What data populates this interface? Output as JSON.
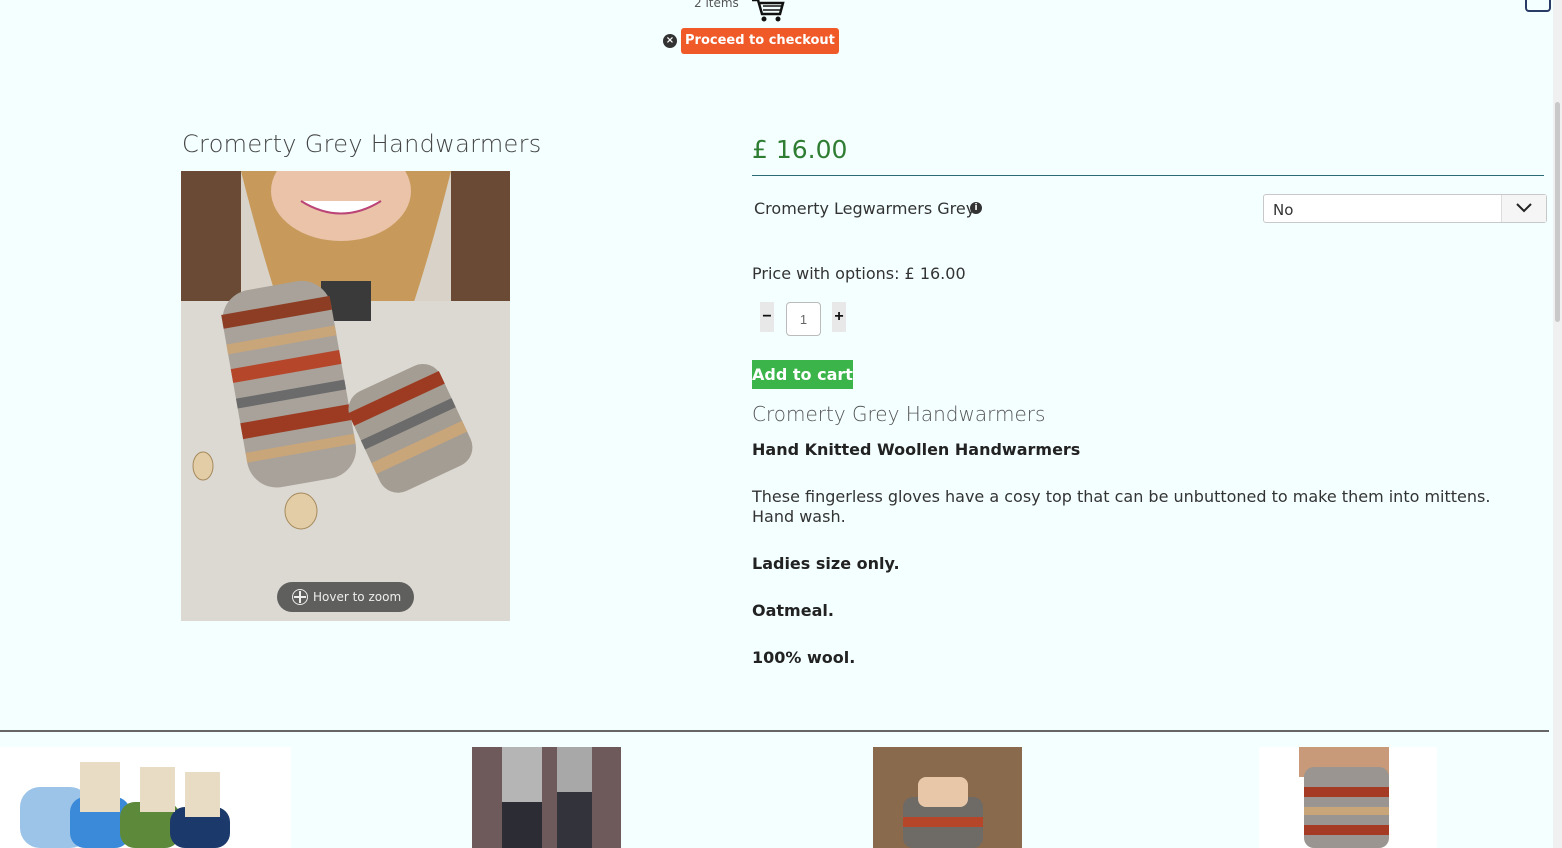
{
  "cart": {
    "count_text": "2 items",
    "checkout_label": "Proceed to checkout",
    "close_symbol": "×"
  },
  "product": {
    "title": "Cromerty Grey Handwarmers",
    "zoom_hint": "Hover to zoom",
    "price": "£ 16.00",
    "option_label": "Cromerty Legwarmers Grey",
    "option_info_symbol": "i",
    "option_selected": "No",
    "price_with_options": "Price with options: £ 16.00",
    "qty_minus": "−",
    "qty_plus": "+",
    "qty_value": "1",
    "add_to_cart": "Add to cart"
  },
  "description": {
    "title": "Cromerty Grey Handwarmers",
    "subtitle": "Hand Knitted Woollen Handwarmers",
    "body": "These fingerless gloves have a cosy top that can be unbuttoned to make them into mittens.  Hand wash.",
    "size_note": "Ladies size only.",
    "colour": "Oatmeal.",
    "material": "100% wool."
  },
  "colors": {
    "accent_price": "#2e7d32",
    "checkout": "#f05a28",
    "add_to_cart": "#3bb54a",
    "background": "#f4ffff"
  },
  "icons": [
    "cart-icon",
    "close-icon",
    "info-icon",
    "chevron-down-icon",
    "zoom-icon"
  ]
}
